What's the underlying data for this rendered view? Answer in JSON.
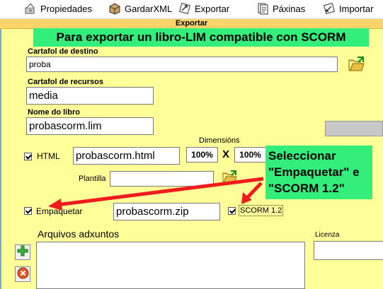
{
  "toolbar": {
    "items": [
      {
        "label": "Propiedades",
        "icon": "wrench-icon"
      },
      {
        "label": "GardarXML",
        "icon": "box-icon"
      },
      {
        "label": "Exportar",
        "icon": "export-arrows-icon"
      },
      {
        "label": "Páxinas",
        "icon": "pages-icon"
      },
      {
        "label": "Importar",
        "icon": "import-arrows-icon"
      }
    ]
  },
  "dialog": {
    "title": "Exportar",
    "banner": "Para exportar un libro-LIM compatible con SCORM",
    "dest_folder": {
      "label": "Cartafol de destino",
      "value": "proba"
    },
    "resource_folder": {
      "label": "Cartafol de recursos",
      "value": "media"
    },
    "book_name": {
      "label": "Nome do libro",
      "value": "probascorm.lim"
    },
    "dimensions_label": "Dimensións",
    "html": {
      "label": "HTML",
      "checked": true,
      "value": "probascorm.html",
      "width": "100%",
      "x": "X",
      "height": "100%"
    },
    "template": {
      "label": "Plantilla",
      "value": ""
    },
    "package": {
      "label": "Empaquetar",
      "checked": true,
      "value": "probascorm.zip"
    },
    "scorm": {
      "label": "SCORM 1.2",
      "checked": true
    },
    "attachments_label": "Arquivos adxuntos",
    "license_label": "Licenza"
  },
  "annotation": {
    "line1": "Seleccionar",
    "line2": "\"Empaquetar\" e",
    "line3": "\"SCORM 1.2\""
  },
  "colors": {
    "panel_bg": "#ffff99",
    "title_bg": "#ffd56a",
    "banner_bg": "#33ee7a",
    "arrow": "#ee1c1c"
  }
}
